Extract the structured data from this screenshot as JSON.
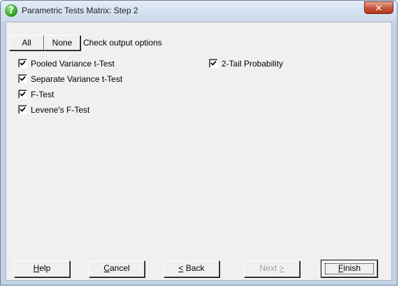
{
  "window": {
    "title": "Parametric Tests Matrix: Step 2",
    "close_label": "✕"
  },
  "select_buttons": {
    "all_label": "All",
    "none_label": "None",
    "caption": "Check output options"
  },
  "options_left": [
    {
      "label": "Pooled Variance t-Test",
      "checked": true
    },
    {
      "label": "Separate Variance t-Test",
      "checked": true
    },
    {
      "label": "F-Test",
      "checked": true
    },
    {
      "label": "Levene's F-Test",
      "checked": true
    }
  ],
  "options_right": [
    {
      "label": "2-Tail Probability",
      "checked": true
    }
  ],
  "footer": {
    "help": {
      "accel": "H",
      "rest": "elp"
    },
    "cancel": {
      "accel": "C",
      "rest": "ancel"
    },
    "back": {
      "accel": "<",
      "rest": " Back"
    },
    "next": {
      "text": "Next ",
      "accel": ">",
      "enabled": false
    },
    "finish": {
      "accel": "F",
      "rest": "inish"
    }
  },
  "icons": {
    "title_icon": "help-question-icon",
    "check": "checkmark-icon"
  }
}
